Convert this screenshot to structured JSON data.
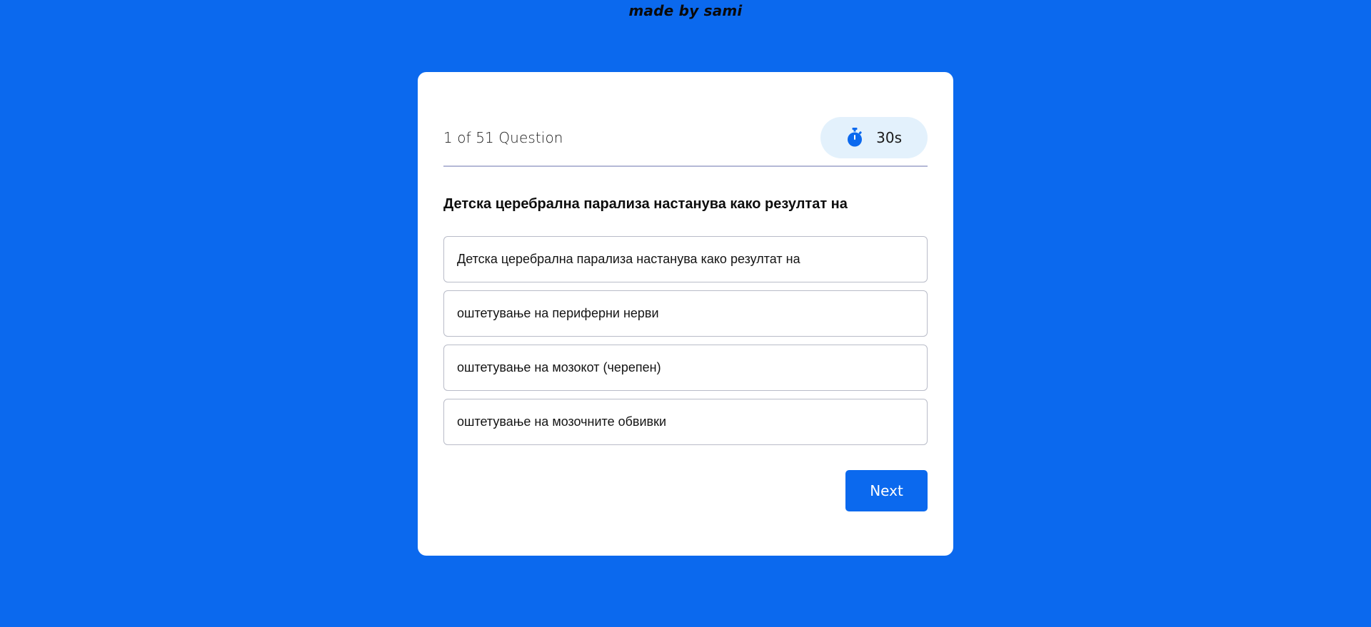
{
  "credit": "made by sami",
  "header": {
    "counter": "1 of 51 Question",
    "timer_icon": "stopwatch-icon",
    "timer_value": "30s"
  },
  "question": {
    "text": "Детска церебрална парализа настанува како резултат на"
  },
  "options": [
    {
      "label": "Детска церебрална парализа настанува како резултат на"
    },
    {
      "label": "оштетување на периферни нерви"
    },
    {
      "label": "оштетување на мозокот (черепен)"
    },
    {
      "label": "оштетување на мозочните обвивки"
    }
  ],
  "actions": {
    "next_label": "Next"
  },
  "colors": {
    "background": "#0b69ee",
    "card": "#ffffff",
    "timer_pill": "#e3f1fc",
    "accent": "#0b69ee",
    "divider": "#b4b8d6",
    "option_border": "#b9bcc8"
  }
}
